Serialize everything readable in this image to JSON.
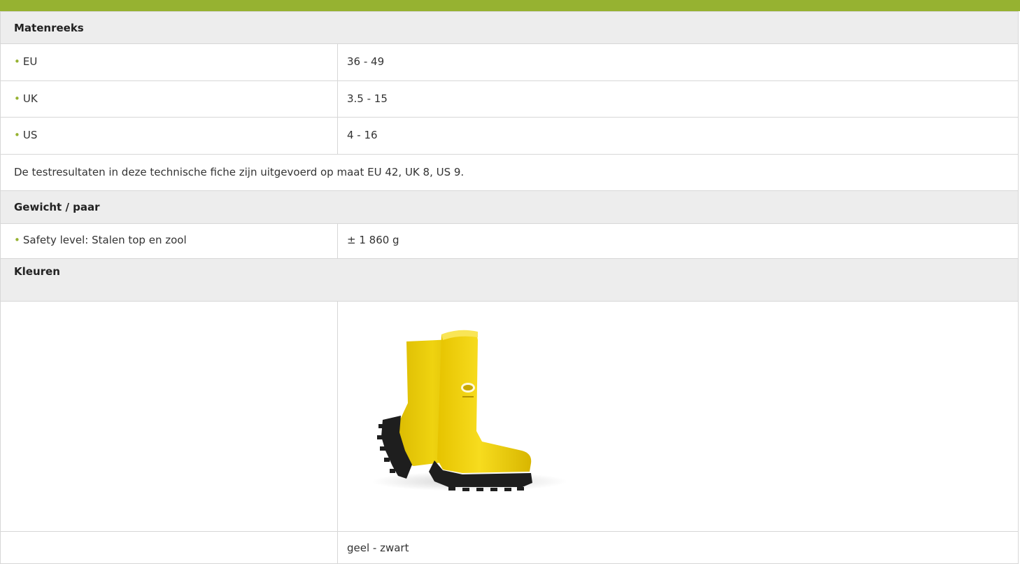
{
  "sections": {
    "size_range": {
      "title": "Matenreeks",
      "rows": [
        {
          "label": "EU",
          "value": "36 - 49"
        },
        {
          "label": "UK",
          "value": "3.5 - 15"
        },
        {
          "label": "US",
          "value": "4 - 16"
        }
      ],
      "note": "De testresultaten in deze technische fiche zijn uitgevoerd op maat EU 42, UK 8, US 9."
    },
    "weight": {
      "title": "Gewicht / paar",
      "rows": [
        {
          "label": "Safety level: Stalen top en zool",
          "value": "± 1 860 g"
        }
      ]
    },
    "colors": {
      "title": "Kleuren",
      "image_icon": "yellow-rubber-boots",
      "color_label": "geel - zwart",
      "brand_green": "#96b231",
      "boot_yellow": "#f2d40d",
      "sole_black": "#1e1e1e"
    }
  }
}
